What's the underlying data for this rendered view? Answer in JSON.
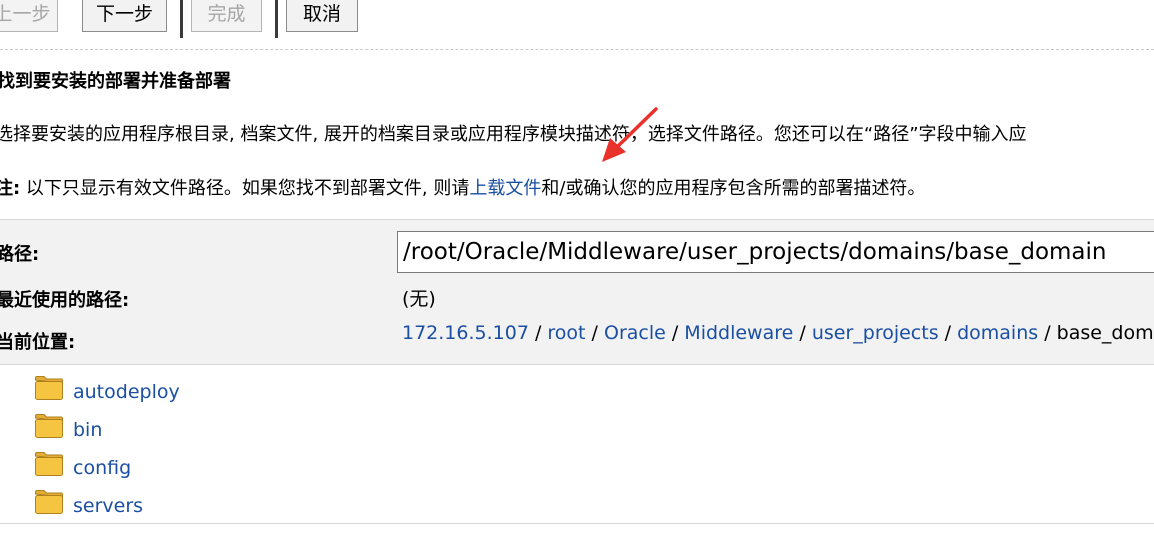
{
  "toolbar": {
    "prev_label": "上一步",
    "next_label": "下一步",
    "finish_label": "完成",
    "cancel_label": "取消"
  },
  "heading": "找到要安装的部署并准备部署",
  "instructions": {
    "para1": "选择要安装的应用程序根目录, 档案文件, 展开的档案目录或应用程序模块描述符，选择文件路径。您还可以在“路径”字段中输入应",
    "note_label": "注:",
    "note_pre": " 以下只显示有效文件路径。如果您找不到部署文件, 则请",
    "upload_link": "上载文件",
    "note_post": "和/或确认您的应用程序包含所需的部署描述符。"
  },
  "form": {
    "path_label": "路径:",
    "path_value": "/root/Oracle/Middleware/user_projects/domains/base_domain",
    "recent_label": "最近使用的路径:",
    "recent_value": "(无)",
    "location_label": "当前位置:",
    "breadcrumbs": [
      "172.16.5.107",
      "root",
      "Oracle",
      "Middleware",
      "user_projects",
      "domains",
      "base_domain"
    ],
    "breadcrumb_separator": " / "
  },
  "folders": [
    "autodeploy",
    "bin",
    "config",
    "servers"
  ],
  "colors": {
    "link": "#1a4fa3",
    "panel_bg": "#f2f2f2",
    "annotation_arrow": "#e8322b",
    "folder_fill": "#f5c542"
  }
}
